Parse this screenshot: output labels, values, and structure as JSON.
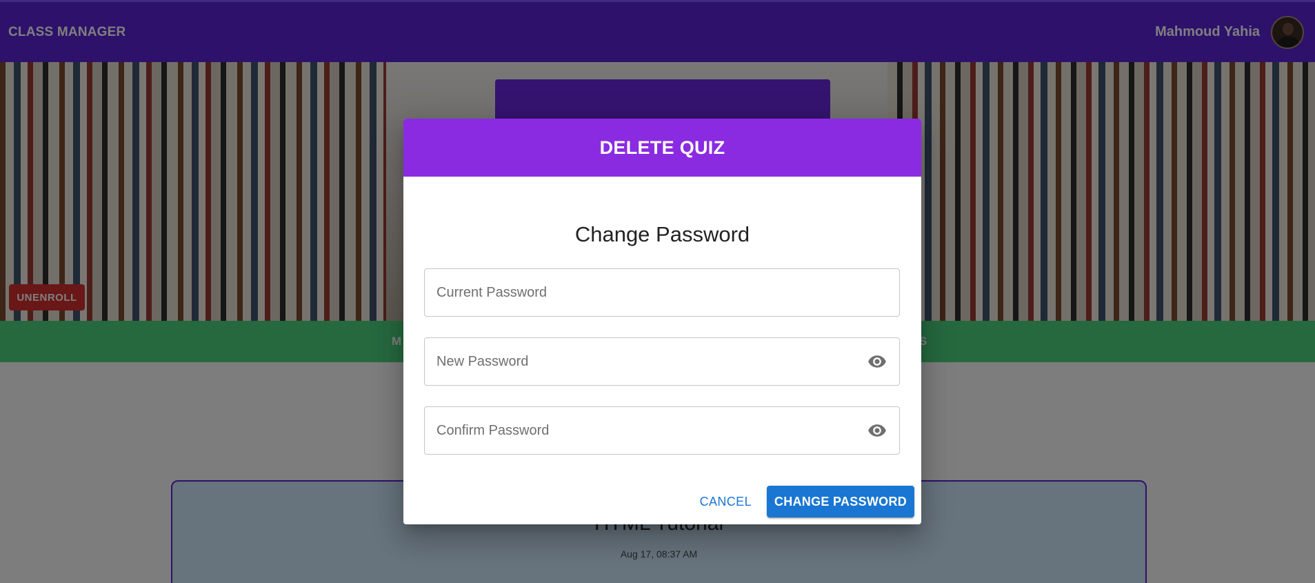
{
  "appbar": {
    "brand": "CLASS MANAGER",
    "user_name": "Mahmoud Yahia"
  },
  "hero": {
    "unenroll_label": "UNENROLL"
  },
  "tabs": {
    "fragment_left": "M",
    "fragment_right": "S"
  },
  "quiz": {
    "title": "HTML Tutorial",
    "time": "Aug 17, 08:37 AM"
  },
  "dialog": {
    "header": "DELETE QUIZ",
    "title": "Change Password",
    "fields": {
      "current_placeholder": "Current Password",
      "new_placeholder": "New Password",
      "confirm_placeholder": "Confirm Password"
    },
    "cancel_label": "CANCEL",
    "submit_label": "CHANGE PASSWORD"
  },
  "colors": {
    "appbar": "#5a22d6",
    "dialog_header": "#8a2be2",
    "primary": "#1976d2",
    "danger": "#d32f2f",
    "tab_strip": "#4cd37f"
  },
  "icons": {
    "password_visibility": "eye-icon"
  }
}
